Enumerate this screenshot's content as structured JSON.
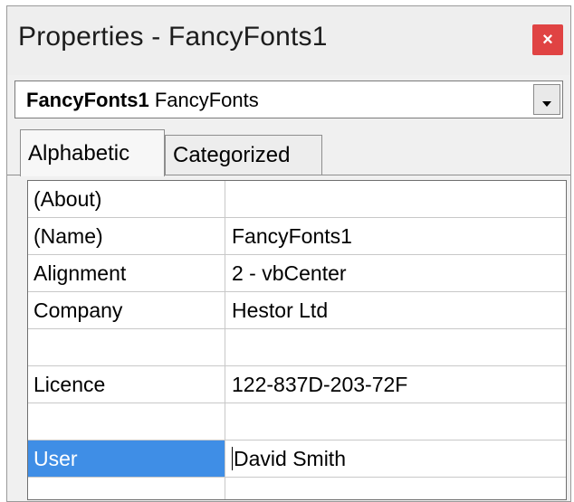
{
  "window": {
    "title": "Properties - FancyFonts1",
    "close_glyph": "×"
  },
  "object_selector": {
    "object_name": "FancyFonts1",
    "object_type": "FancyFonts"
  },
  "tabs": [
    {
      "label": "Alphabetic",
      "active": true
    },
    {
      "label": "Categorized",
      "active": false
    }
  ],
  "properties": [
    {
      "name": "(About)",
      "value": ""
    },
    {
      "name": "(Name)",
      "value": "FancyFonts1"
    },
    {
      "name": "Alignment",
      "value": "2 - vbCenter"
    },
    {
      "name": "Company",
      "value": "Hestor Ltd"
    },
    {
      "name": "",
      "value": ""
    },
    {
      "name": "Licence",
      "value": "122-837D-203-72F"
    },
    {
      "name": "",
      "value": ""
    },
    {
      "name": "User",
      "value": "David Smith",
      "selected": true
    },
    {
      "name": "",
      "value": ""
    }
  ],
  "colors": {
    "selection": "#3f8ee6",
    "close_button": "#e04343"
  }
}
